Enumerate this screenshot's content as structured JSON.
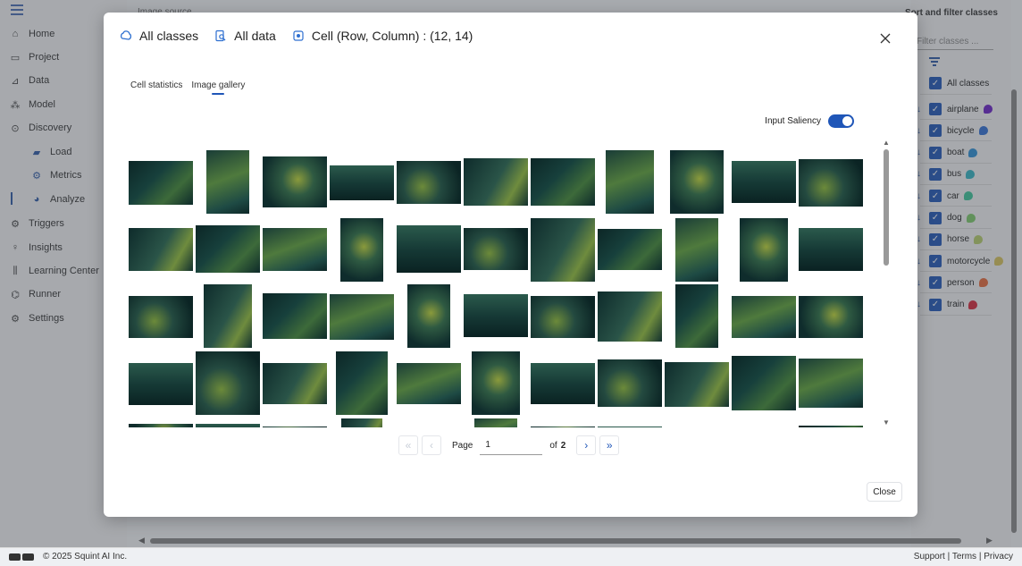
{
  "app": {
    "topbar_title": "Image source",
    "nav": [
      {
        "label": "Home",
        "icon": "home-icon"
      },
      {
        "label": "Project",
        "icon": "project-icon"
      },
      {
        "label": "Data",
        "icon": "data-icon"
      },
      {
        "label": "Model",
        "icon": "model-icon"
      },
      {
        "label": "Discovery",
        "icon": "discovery-icon"
      },
      {
        "label": "Load",
        "icon": "folder-icon"
      },
      {
        "label": "Metrics",
        "icon": "metrics-icon"
      },
      {
        "label": "Analyze",
        "icon": "analyze-icon"
      },
      {
        "label": "Triggers",
        "icon": "triggers-icon"
      },
      {
        "label": "Insights",
        "icon": "insights-icon"
      },
      {
        "label": "Learning Center",
        "icon": "learning-center-icon"
      },
      {
        "label": "Runner",
        "icon": "runner-icon"
      },
      {
        "label": "Settings",
        "icon": "settings-icon"
      }
    ],
    "right_panel": {
      "title": "Sort and filter classes",
      "filter_placeholder": "Filter classes ...",
      "all_label": "All classes",
      "classes": [
        {
          "label": "airplane",
          "color": "#6a1fc9"
        },
        {
          "label": "bicycle",
          "color": "#2f6fd6"
        },
        {
          "label": "boat",
          "color": "#2a90d8"
        },
        {
          "label": "bus",
          "color": "#33b6c4"
        },
        {
          "label": "car",
          "color": "#3cc79a"
        },
        {
          "label": "dog",
          "color": "#7ccc6a"
        },
        {
          "label": "horse",
          "color": "#b7cf6c"
        },
        {
          "label": "motorcycle",
          "color": "#d9c45c"
        },
        {
          "label": "person",
          "color": "#e8693a"
        },
        {
          "label": "train",
          "color": "#d8263a"
        }
      ]
    },
    "footer": {
      "copyright": "© 2025 Squint AI Inc.",
      "support": "Support",
      "terms": "Terms",
      "privacy": "Privacy"
    }
  },
  "modal": {
    "header": {
      "classes": "All classes",
      "data": "All data",
      "cell": "Cell (Row, Column) : (12, 14)"
    },
    "tabs": [
      {
        "label": "Cell statistics",
        "active": false
      },
      {
        "label": "Image gallery",
        "active": true
      }
    ],
    "saliency_label": "Input Saliency",
    "saliency_on": true,
    "pagination": {
      "page_label": "Page",
      "current_page": "1",
      "of_label": "of",
      "total_pages": "2"
    },
    "close_label": "Close"
  },
  "colors": {
    "accent": "#1f56b8",
    "thumb_dark": "#0f2a2a",
    "thumb_mid": "#1d4a44",
    "thumb_light": "#5b7a3a"
  }
}
